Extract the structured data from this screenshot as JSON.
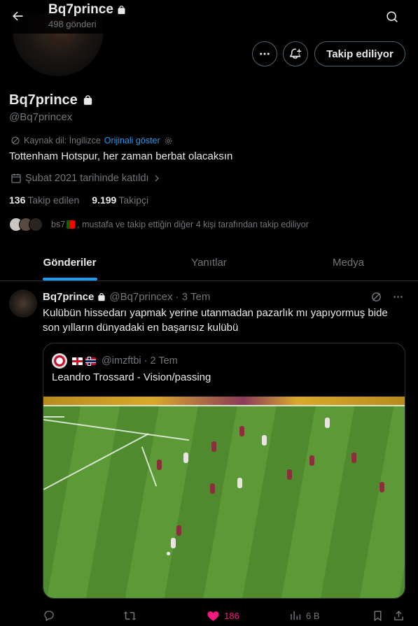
{
  "header": {
    "title": "Bq7prince",
    "post_count": "498 gönderi"
  },
  "profile": {
    "name": "Bq7prince",
    "handle": "@Bq7princex",
    "translate_label": "Kaynak dil: İngilizce",
    "translate_link": "Orijinali göster",
    "bio": "Tottenham Hotspur, her zaman berbat olacaksın",
    "joined": "Şubat 2021 tarihinde katıldı",
    "following_count": "136",
    "following_label": "Takip edilen",
    "followers_count": "9.199",
    "followers_label": "Takipçi",
    "followed_by_name": "bs7",
    "followed_by_rest": ", mustafa ve takip ettiğin diğer 4 kişi tarafından takip ediliyor",
    "follow_button": "Takip ediliyor"
  },
  "tabs": [
    {
      "label": "Gönderiler",
      "active": true
    },
    {
      "label": "Yanıtlar",
      "active": false
    },
    {
      "label": "Medya",
      "active": false
    }
  ],
  "tweet": {
    "name": "Bq7prince",
    "handle": "@Bq7princex",
    "time": "· 3 Tem",
    "text": "Kulübün hissedarı yapmak yerine utanmadan pazarlık mı yapıyormuş bide son yılların dünyadaki en başarısız kulübü",
    "quote": {
      "handle": "@imzftbi",
      "time": "· 2 Tem",
      "text": "Leandro Trossard - Vision/passing"
    },
    "likes": "186",
    "views": "6 B"
  },
  "colors": {
    "accent": "#1d9bf0",
    "like": "#f91880",
    "muted": "#71767b",
    "border": "#2f3336"
  }
}
